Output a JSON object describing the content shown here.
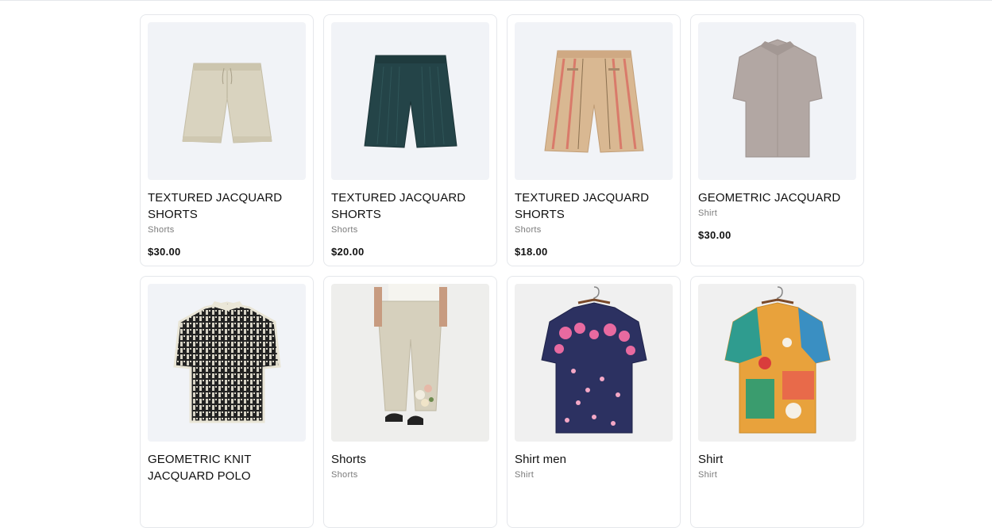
{
  "products": [
    {
      "name": "TEXTURED JACQUARD SHORTS",
      "category": "Shorts",
      "price": "$30.00",
      "image_icon": "beige-shorts-image",
      "color": "#d9d3bf"
    },
    {
      "name": "TEXTURED JACQUARD SHORTS",
      "category": "Shorts",
      "price": "$20.00",
      "image_icon": "dark-green-shorts-image",
      "color": "#244448"
    },
    {
      "name": "TEXTURED JACQUARD SHORTS",
      "category": "Shorts",
      "price": "$18.00",
      "image_icon": "striped-shorts-image",
      "color": "#d9b892"
    },
    {
      "name": "GEOMETRIC JACQUARD",
      "category": "Shirt",
      "price": "$30.00",
      "image_icon": "taupe-shirt-image",
      "color": "#b2a7a3"
    },
    {
      "name": "GEOMETRIC KNIT JACQUARD POLO",
      "category": "",
      "price": "",
      "image_icon": "knit-polo-image",
      "color": "#2a2a2a"
    },
    {
      "name": "Shorts",
      "category": "Shorts",
      "price": "",
      "image_icon": "floral-trousers-image",
      "color": "#d6d0bd"
    },
    {
      "name": "Shirt men",
      "category": "Shirt",
      "price": "",
      "image_icon": "floral-navy-shirt-image",
      "color": "#2c3161"
    },
    {
      "name": "Shirt",
      "category": "Shirt",
      "price": "",
      "image_icon": "colorful-shirt-image",
      "color": "#e8a23c"
    }
  ]
}
